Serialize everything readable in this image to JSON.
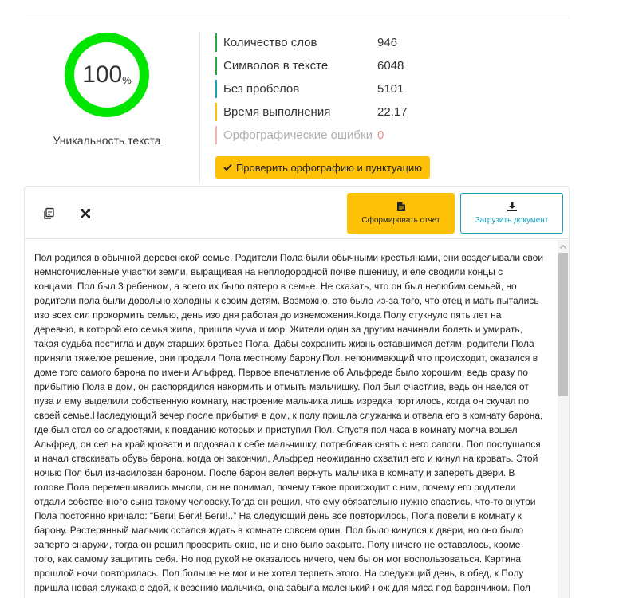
{
  "uniqueness": {
    "value": "100",
    "unit": "%",
    "label": "Уникальность текста",
    "ring_color": "#00e600"
  },
  "stats": [
    {
      "label": "Количество слов",
      "value": "946",
      "color": "#28a745"
    },
    {
      "label": "Символов в тексте",
      "value": "6048",
      "color": "#28a745"
    },
    {
      "label": "Без пробелов",
      "value": "5101",
      "color": "#17a2b8"
    },
    {
      "label": "Время выполнения",
      "value": "22.17",
      "color": "#ffc107"
    },
    {
      "label": "Орфографические ошибки",
      "value": "0",
      "color": "#f5b5b5"
    }
  ],
  "check_button": {
    "label": "Проверить орфографию и пунктуацию",
    "icon": "check-icon"
  },
  "toolbar": {
    "copy_icon": "copy-icon",
    "expand_icon": "expand-icon",
    "report_label": "Сформировать отчет",
    "report_icon": "document-icon",
    "upload_label": "Загрузить документ",
    "upload_icon": "download-icon"
  },
  "accent": {
    "yellow": "#ffc107",
    "teal": "#17a2b8"
  },
  "text_lines": [
    "Пол родился в обычной деревенской семье. Родители Пола были обычными крестьянами, они возделывали свои",
    "немногочисленные участки земли, выращивая на неплодородной почве пшеницу, и еле сводили концы с",
    "концами. Пол был 3 ребенком, а всего их было пятеро в семье. Не сказать, что он был нелюбим семьей, но",
    "родители пола были довольно холодны к своим детям. Возможно, это было из-за того, что отец и мать пытались",
    "изо всех сил прокормить семью, день изо дня работая до изнеможения.Когда Полу стукнуло пять лет на",
    "деревню, в которой его семья жила, пришла чума и мор. Жители один за другим начинали болеть и умирать,",
    "такая судьба постигла и двух старших братьев Пола. Дабы сохранить жизнь оставшимся детям, родители Пола",
    "приняли тяжелое решение, они продали Пола местному барону.Пол, непонимающий что происходит, оказался в",
    "доме того самого барона по имени Альфред. Первое впечатление об Альфреде было хорошим, ведь сразу по",
    "прибытию Пола в дом, он распорядился накормить и отмыть мальчишку. Пол был счастлив, ведь он наелся от",
    "пуза и ему выделили собственную комнату, настроение мальчика лишь изредка портилось, когда он скучал по",
    "своей семье.Наследующий вечер после прибытия в дом, к полу пришла служанка и отвела его в комнату барона,",
    "где был стол со сладостями, к поеданию которых и приступил Пол. Спустя пол часа в комнату молча вошел",
    "Альфред, он сел на край кровати и подозвал к себе мальчишку, потребовав снять с него сапоги. Пол послушался",
    "и начал стаскивать обувь барона, когда он закончил, Альфред неожиданно схватил его и кинул на кровать. Этой",
    "ночью Пол был изнасилован бароном. После барон велел вернуть мальчика в комнату и запереть двери. В",
    "голове Пола перемешивались мысли, он не понимал, почему такое происходит с ним, почему его родители",
    "отдали собственного сына такому человеку.Тогда он решил, что ему обязательно нужно спастись, что-то внутри",
    "Пола постоянно кричало: “Беги! Беги! Беги!..” На следующий день все повторилось, Пола повели в комнату к",
    "барону. Растерянный мальчик остался ждать в комнате совсем один. Пол было кинулся к двери, но оно было",
    "заперто снаружи, тогда он решил проверить окно, но и оно было закрыто. Полу ничего не оставалось, кроме",
    "того, как самому защитить себя. Но под рукой не оказалось ничего, чем бы он мог воспользоваться. Картина",
    "прошлой ночи повторилась. Пол больше не мог и не хотел терпеть этого. На следующий день, в обед, к Полу",
    "пришла новая служака с едой, к везению мальчика, она забыла маленький нож для мяса под баранчиком. Пол"
  ]
}
